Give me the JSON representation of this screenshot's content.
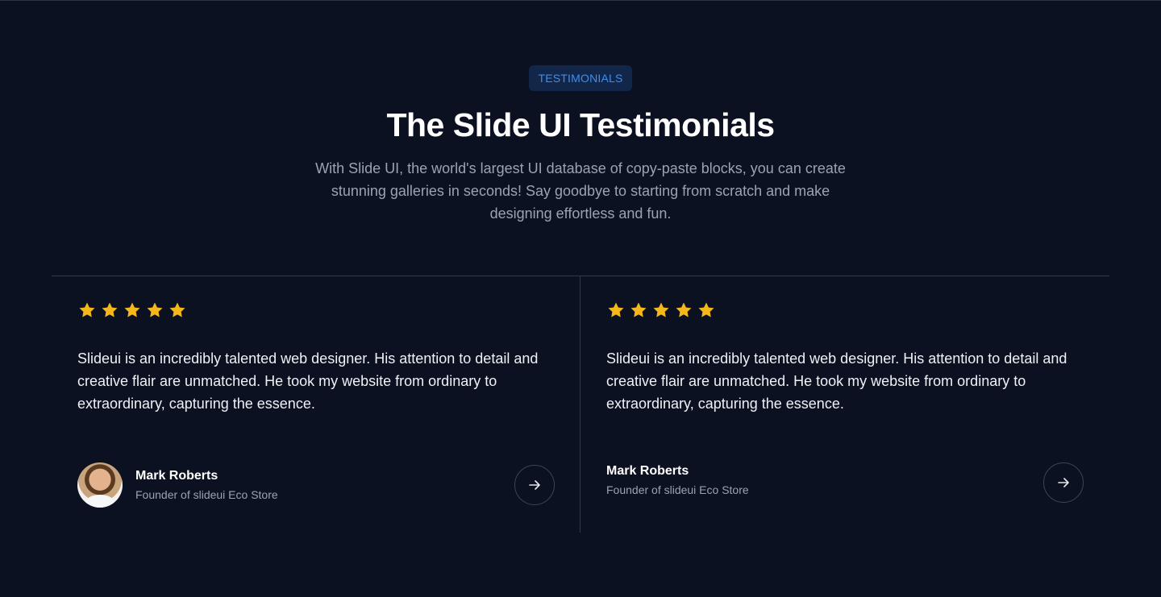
{
  "section": {
    "badge": "TESTIMONIALS",
    "title": "The Slide UI Testimonials",
    "subtitle": "With Slide UI, the world's largest UI database of copy-paste blocks, you can create stunning galleries in seconds! Say goodbye to starting from scratch and make designing effortless and fun."
  },
  "testimonials": [
    {
      "rating": 5,
      "quote": "Slideui is an incredibly talented web designer. His attention to detail and creative flair are unmatched. He took my website from ordinary to extraordinary, capturing the essence.",
      "name": "Mark Roberts",
      "role": "Founder of slideui Eco Store",
      "has_avatar": true
    },
    {
      "rating": 5,
      "quote": "Slideui is an incredibly talented web designer. His attention to detail and creative flair are unmatched. He took my website from ordinary to extraordinary, capturing the essence.",
      "name": "Mark Roberts",
      "role": "Founder of slideui Eco Store",
      "has_avatar": false
    }
  ],
  "icons": {
    "star": "star-icon",
    "arrow": "arrow-right-icon"
  },
  "colors": {
    "background": "#0b1120",
    "accent": "#3b8ff0",
    "star": "#f5b81c"
  }
}
